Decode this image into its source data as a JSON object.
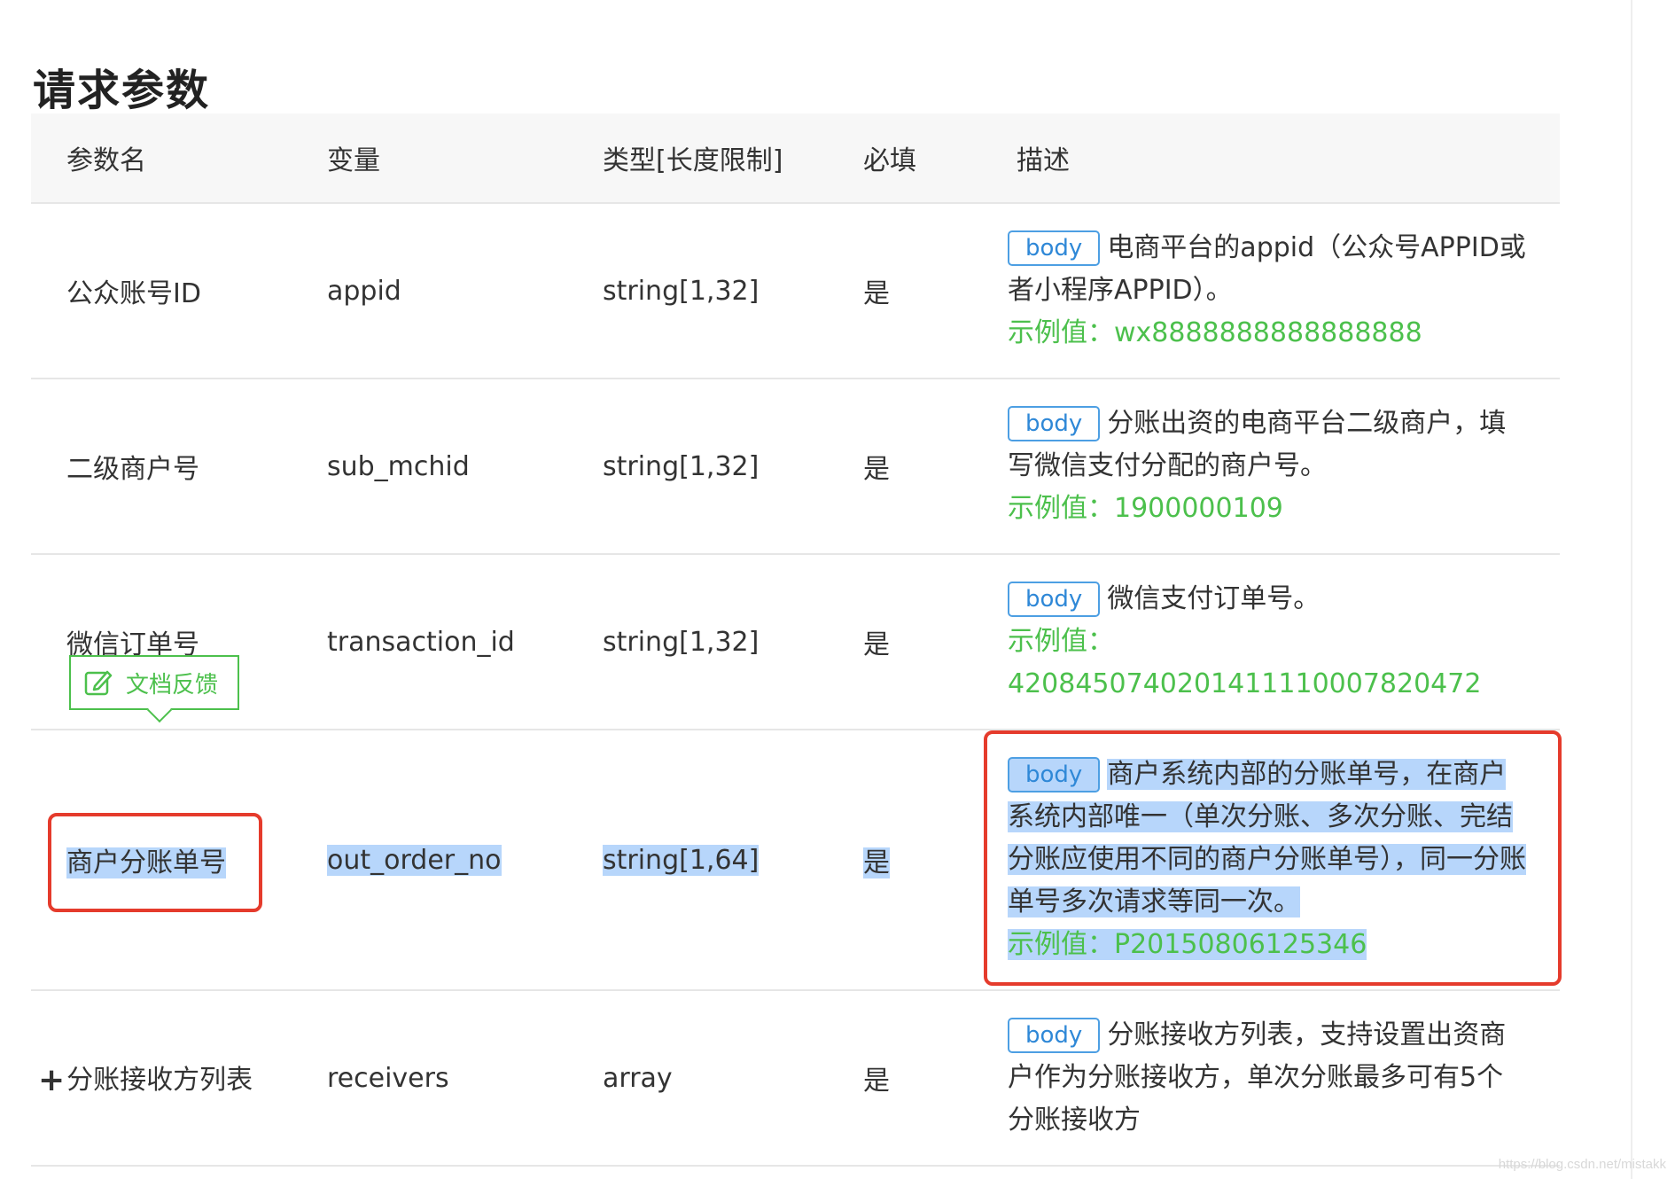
{
  "page": {
    "title": "请求参数",
    "watermark": "https://blog.csdn.net/mistakk"
  },
  "table": {
    "headers": [
      "参数名",
      "变量",
      "类型[长度限制]",
      "必填",
      "描述"
    ],
    "rows": [
      {
        "name": "公众账号ID",
        "variable": "appid",
        "type": "string[1,32]",
        "required": "是",
        "tag": "body",
        "desc": "电商平台的appid（公众号APPID或者小程序APPID）。",
        "example": "示例值：wx8888888888888888"
      },
      {
        "name": "二级商户号",
        "variable": "sub_mchid",
        "type": "string[1,32]",
        "required": "是",
        "tag": "body",
        "desc": "分账出资的电商平台二级商户，填写微信支付分配的商户号。",
        "example": "示例值：1900000109"
      },
      {
        "name": "微信订单号",
        "variable": "transaction_id",
        "type": "string[1,32]",
        "required": "是",
        "tag": "body",
        "desc": "微信支付订单号。",
        "example": "示例值： 4208450740201411110007820472"
      },
      {
        "name": "商户分账单号",
        "variable": "out_order_no",
        "type": "string[1,64]",
        "required": "是",
        "tag": "body",
        "desc": "商户系统内部的分账单号，在商户系统内部唯一（单次分账、多次分账、完结分账应使用不同的商户分账单号），同一分账单号多次请求等同一次。",
        "example": "示例值：P20150806125346"
      },
      {
        "expand": "+",
        "name": "分账接收方列表",
        "variable": "receivers",
        "type": "array",
        "required": "是",
        "tag": "body",
        "desc": "分账接收方列表，支持设置出资商户作为分账接收方，单次分账最多可有5个分账接收方",
        "example": ""
      }
    ]
  },
  "feedback": {
    "label": "文档反馈",
    "icon": "edit-icon"
  },
  "colors": {
    "tag_blue": "#2f88d7",
    "example_green": "#4cc04c",
    "highlight": "#b7d6fb",
    "annotation_red": "#e53b2c"
  }
}
